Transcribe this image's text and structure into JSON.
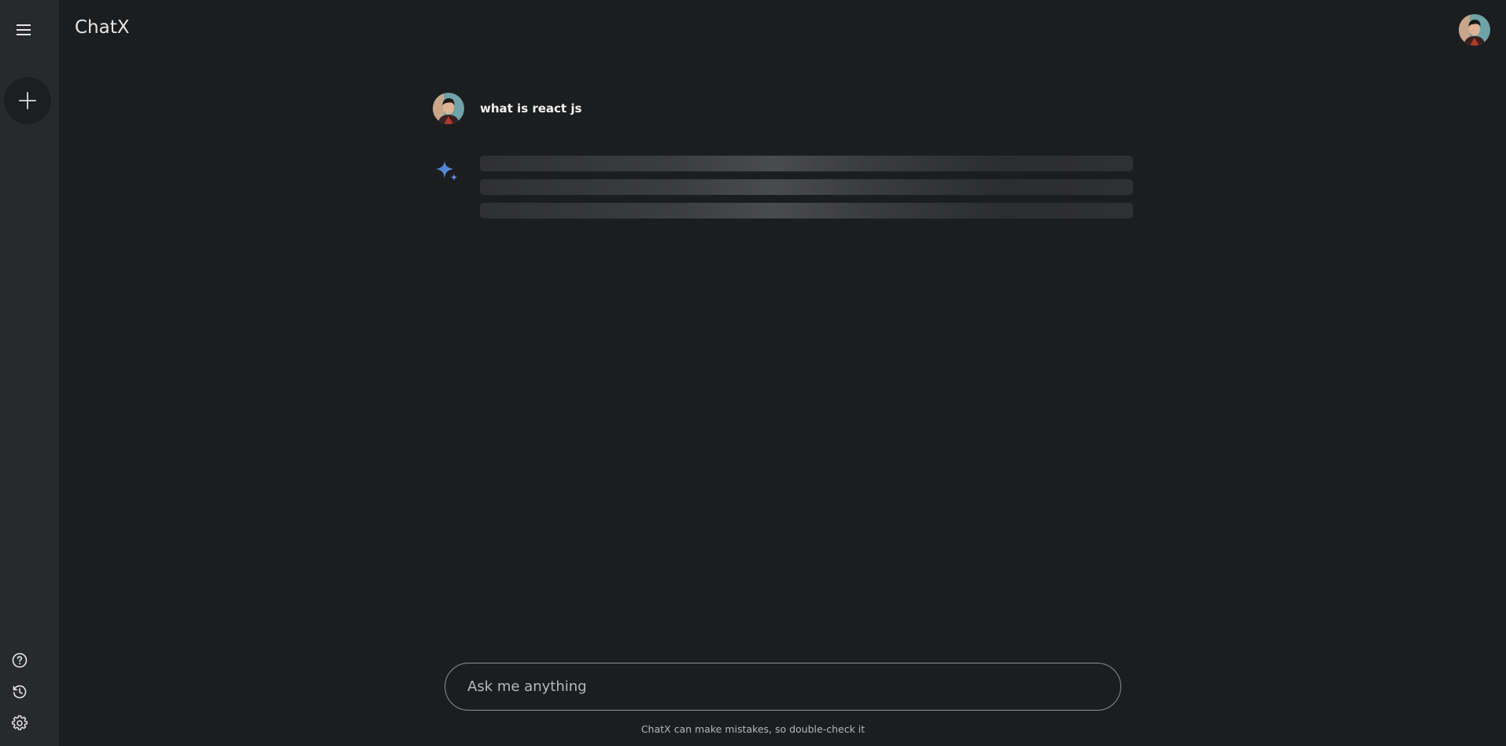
{
  "app": {
    "title": "ChatX"
  },
  "sidebar": {
    "menu_icon": "hamburger-menu-icon",
    "new_chat_icon": "plus-icon",
    "bottom_icons": [
      "help-circle-icon",
      "history-icon",
      "gear-icon"
    ]
  },
  "header": {
    "avatar": "user-avatar"
  },
  "chat": {
    "user_message": "what is react js",
    "assistant_icon": "sparkle-icon",
    "assistant_state": "loading"
  },
  "composer": {
    "placeholder": "Ask me anything",
    "value": ""
  },
  "footer": {
    "disclaimer": "ChatX can make mistakes, so double-check it"
  },
  "colors": {
    "background": "#1c1d1f",
    "sidebar": "#28292c",
    "accent": "#4a86d8"
  }
}
